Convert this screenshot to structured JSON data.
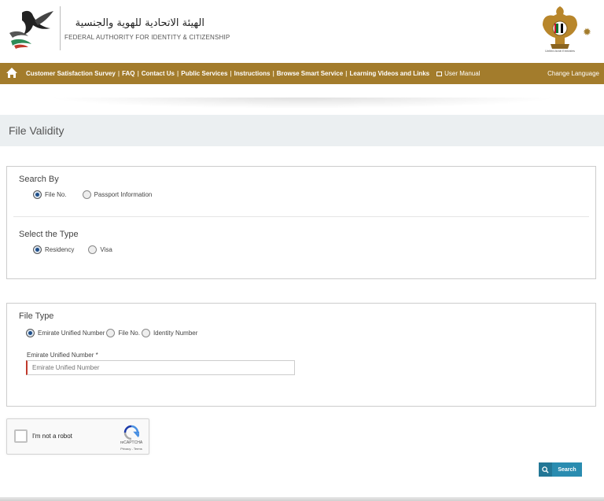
{
  "header": {
    "org_name_ar": "الهيئة الاتحادية للهوية والجنسية",
    "org_name_en": "FEDERAL AUTHORITY FOR IDENTITY & CITIZENSHIP",
    "emblem_caption": "United Arab Emirates",
    "settings_icon": "gear-icon"
  },
  "nav": {
    "home_icon": "home-icon",
    "links": [
      "Customer Satisfaction Survey",
      "FAQ",
      "Contact Us",
      "Public Services",
      "Instructions",
      "Browse Smart Service",
      "Learning Videos and Links"
    ],
    "user_manual": "User Manual",
    "change_language": "Change Language"
  },
  "page": {
    "title": "File Validity"
  },
  "search_by": {
    "label": "Search By",
    "options": [
      "File No.",
      "Passport Information"
    ],
    "selected": "File No."
  },
  "select_type": {
    "label": "Select the Type",
    "options": [
      "Residency",
      "Visa"
    ],
    "selected": "Residency"
  },
  "file_type": {
    "label": "File Type",
    "options": [
      "Emirate Unified Number",
      "File No.",
      "Identity Number"
    ],
    "selected": "Emirate Unified Number",
    "field_label": "Emirate Unified Number *",
    "field_placeholder": "Emirate Unified Number",
    "field_value": ""
  },
  "captcha": {
    "label": "I'm not a robot",
    "brand": "reCAPTCHA",
    "terms": "Privacy - Terms"
  },
  "actions": {
    "search_label": "Search"
  },
  "colors": {
    "brand_gold": "#a37c2c",
    "title_band": "#ebeff1",
    "button_blue": "#2a8cb0"
  }
}
